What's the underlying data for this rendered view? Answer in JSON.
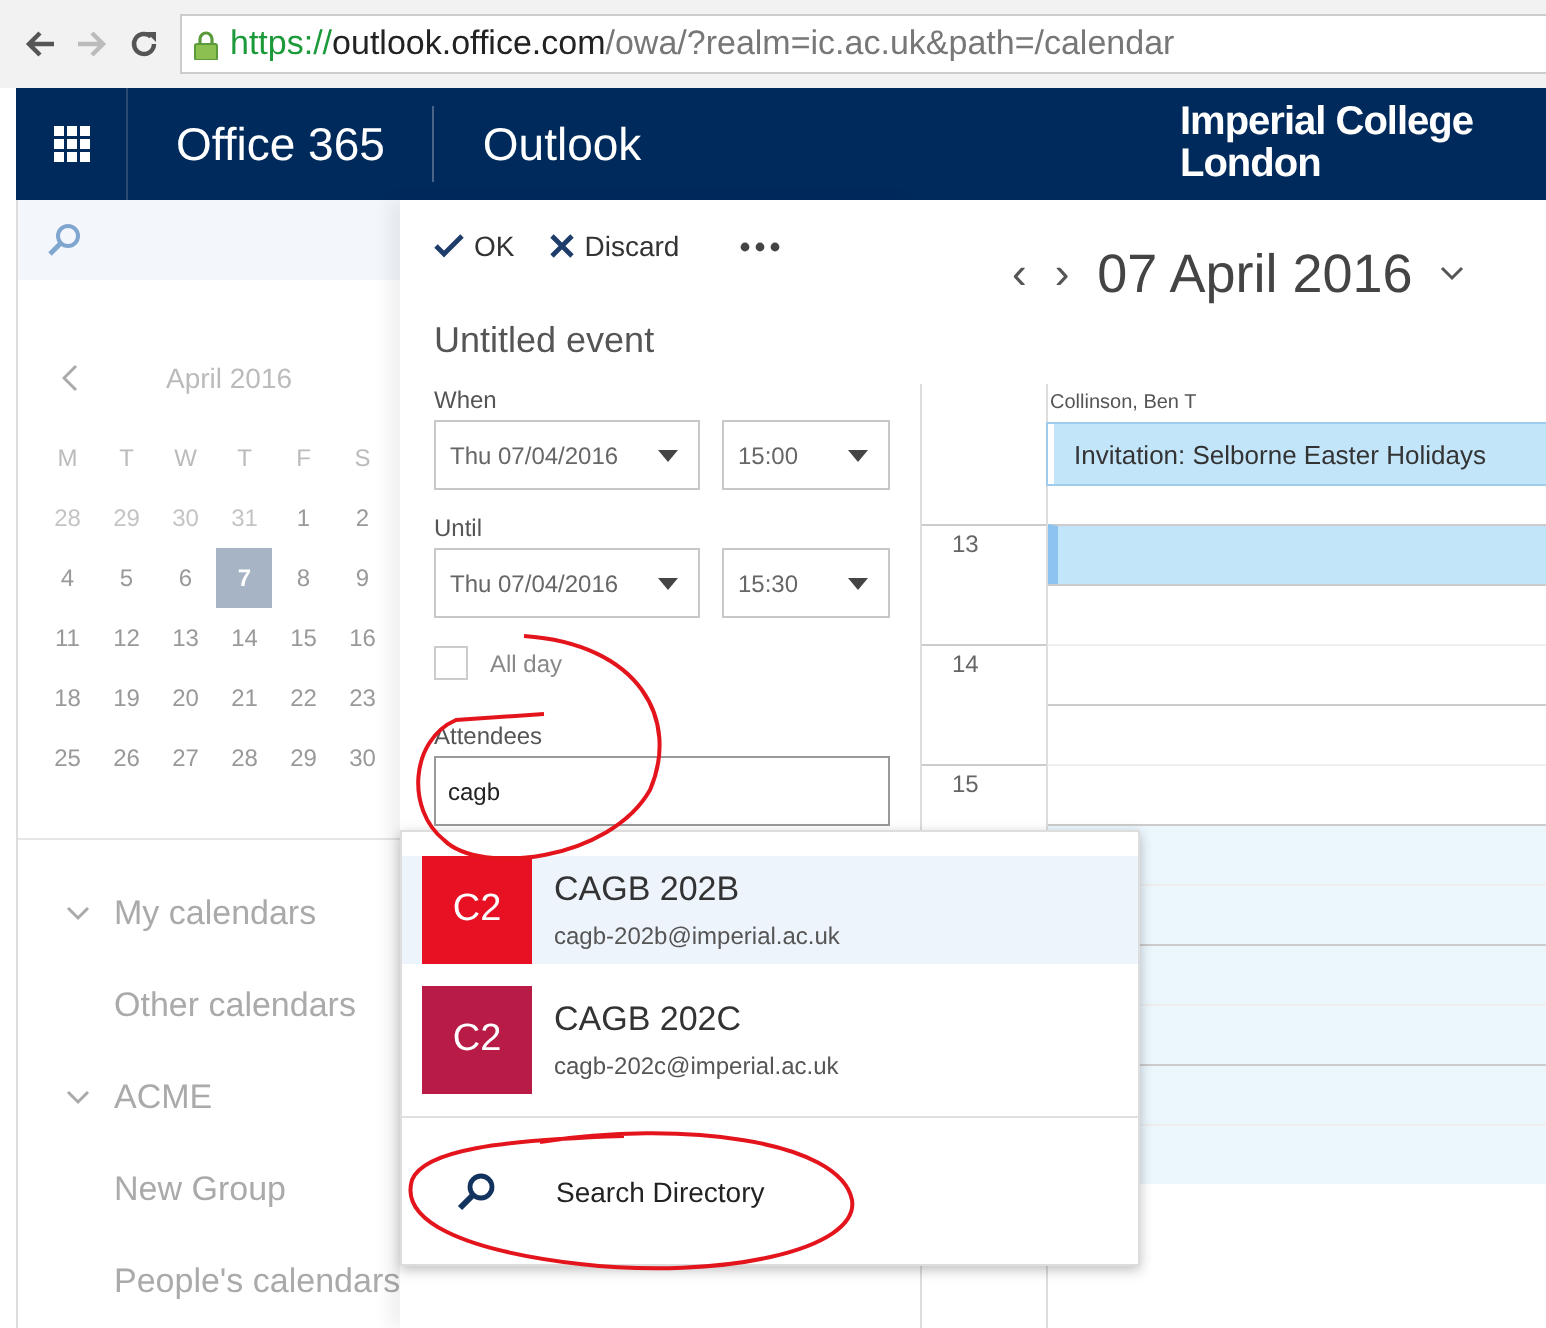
{
  "browser": {
    "url_scheme": "https://",
    "url_host": "outlook.office.com",
    "url_path": "/owa/?realm=ic.ac.uk&path=/calendar"
  },
  "header": {
    "suite": "Office 365",
    "app": "Outlook",
    "org_line1": "Imperial College",
    "org_line2": "London"
  },
  "mini_calendar": {
    "month": "April 2016",
    "weekdays": [
      "M",
      "T",
      "W",
      "T",
      "F",
      "S"
    ],
    "weeks": [
      [
        {
          "day": "28",
          "muted": true,
          "selected": false
        },
        {
          "day": "29",
          "muted": true,
          "selected": false
        },
        {
          "day": "30",
          "muted": true,
          "selected": false
        },
        {
          "day": "31",
          "muted": true,
          "selected": false
        },
        {
          "day": "1",
          "muted": false,
          "selected": false
        },
        {
          "day": "2",
          "muted": false,
          "selected": false
        }
      ],
      [
        {
          "day": "4",
          "muted": false,
          "selected": false
        },
        {
          "day": "5",
          "muted": false,
          "selected": false
        },
        {
          "day": "6",
          "muted": false,
          "selected": false
        },
        {
          "day": "7",
          "muted": false,
          "selected": true
        },
        {
          "day": "8",
          "muted": false,
          "selected": false
        },
        {
          "day": "9",
          "muted": false,
          "selected": false
        }
      ],
      [
        {
          "day": "11",
          "muted": false,
          "selected": false
        },
        {
          "day": "12",
          "muted": false,
          "selected": false
        },
        {
          "day": "13",
          "muted": false,
          "selected": false
        },
        {
          "day": "14",
          "muted": false,
          "selected": false
        },
        {
          "day": "15",
          "muted": false,
          "selected": false
        },
        {
          "day": "16",
          "muted": false,
          "selected": false
        }
      ],
      [
        {
          "day": "18",
          "muted": false,
          "selected": false
        },
        {
          "day": "19",
          "muted": false,
          "selected": false
        },
        {
          "day": "20",
          "muted": false,
          "selected": false
        },
        {
          "day": "21",
          "muted": false,
          "selected": false
        },
        {
          "day": "22",
          "muted": false,
          "selected": false
        },
        {
          "day": "23",
          "muted": false,
          "selected": false
        }
      ],
      [
        {
          "day": "25",
          "muted": false,
          "selected": false
        },
        {
          "day": "26",
          "muted": false,
          "selected": false
        },
        {
          "day": "27",
          "muted": false,
          "selected": false
        },
        {
          "day": "28",
          "muted": false,
          "selected": false
        },
        {
          "day": "29",
          "muted": false,
          "selected": false
        },
        {
          "day": "30",
          "muted": false,
          "selected": false
        }
      ]
    ]
  },
  "sidebar": {
    "items": [
      {
        "label": "My calendars",
        "kind": "group"
      },
      {
        "label": "Other calendars",
        "kind": "item"
      },
      {
        "label": "ACME",
        "kind": "group"
      },
      {
        "label": "New Group",
        "kind": "item"
      },
      {
        "label": "People's calendars",
        "kind": "item"
      }
    ]
  },
  "event_form": {
    "ok": "OK",
    "discard": "Discard",
    "title_placeholder": "Untitled event",
    "when": {
      "label": "When",
      "date": "Thu 07/04/2016",
      "time": "15:00"
    },
    "until": {
      "label": "Until",
      "date": "Thu 07/04/2016",
      "time": "15:30"
    },
    "all_day": {
      "label": "All day",
      "checked": false
    },
    "attendees": {
      "label": "Attendees",
      "value": "cagb"
    }
  },
  "suggestions": {
    "items": [
      {
        "initials": "C2",
        "name": "CAGB 202B",
        "email": "cagb-202b@imperial.ac.uk",
        "color": "#e81123",
        "selected": true
      },
      {
        "initials": "C2",
        "name": "CAGB 202C",
        "email": "cagb-202c@imperial.ac.uk",
        "color": "#b81c46",
        "selected": false
      }
    ],
    "search_directory": "Search Directory"
  },
  "calendar": {
    "prev": "‹",
    "next": "›",
    "date": "07 April 2016",
    "person": "Collinson, Ben T",
    "all_day_event": "Invitation: Selborne Easter Holidays",
    "hours": [
      "13",
      "14",
      "15"
    ]
  }
}
